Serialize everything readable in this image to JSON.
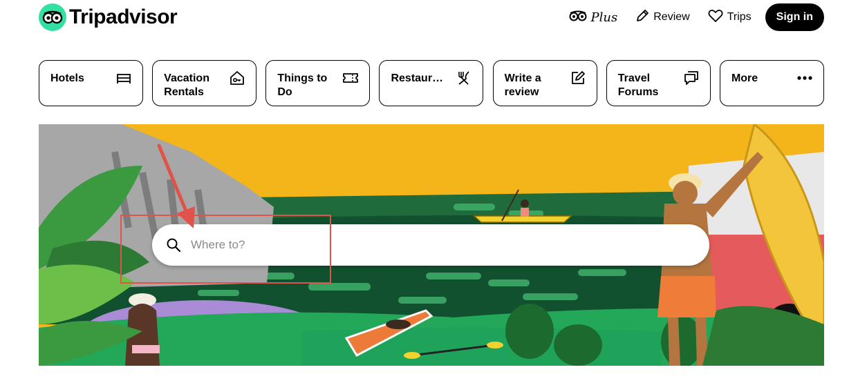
{
  "brand": {
    "name": "Tripadvisor",
    "logo_icon": "owl-eyes-icon",
    "color": "#34e0a1"
  },
  "topnav": {
    "plus_label": "Plus",
    "review_label": "Review",
    "trips_label": "Trips",
    "signin_label": "Sign in"
  },
  "categories": [
    {
      "label": "Hotels",
      "icon": "bed-icon"
    },
    {
      "label": "Vacation Rentals",
      "icon": "house-key-icon"
    },
    {
      "label": "Things to Do",
      "icon": "ticket-icon"
    },
    {
      "label": "Restaurants",
      "icon": "fork-knife-icon"
    },
    {
      "label": "Write a review",
      "icon": "edit-icon"
    },
    {
      "label": "Travel Forums",
      "icon": "chat-bubbles-icon"
    },
    {
      "label": "More",
      "icon": "more-dots-icon"
    }
  ],
  "search": {
    "placeholder": "Where to?",
    "value": ""
  },
  "annotation": {
    "color": "#e0534a"
  }
}
